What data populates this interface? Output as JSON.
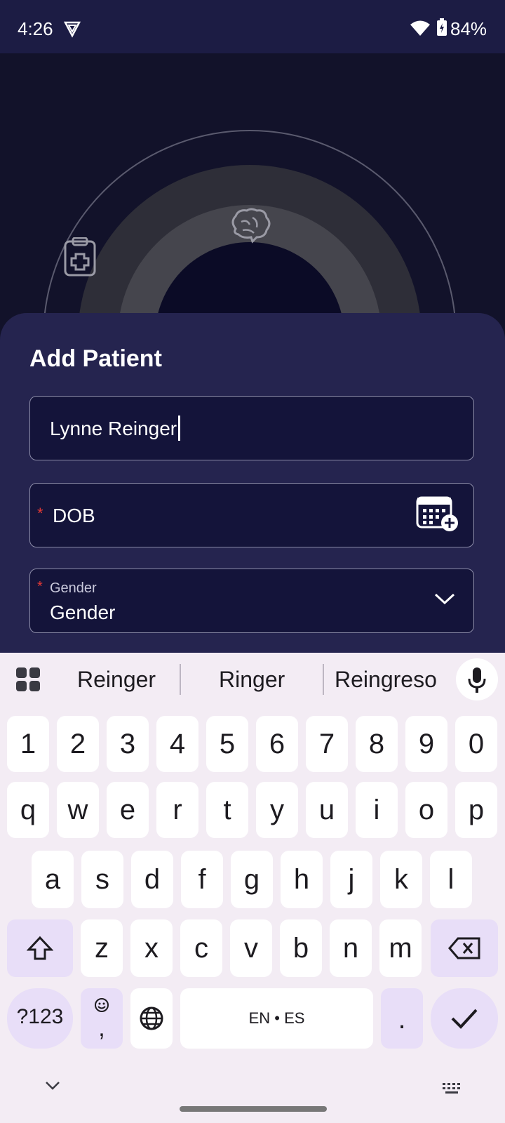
{
  "status_bar": {
    "time": "4:26",
    "battery_percent": "84%",
    "vpn_icon": "shield-vpn-icon",
    "wifi_icon": "wifi-icon",
    "battery_icon": "battery-charging-icon"
  },
  "hero": {
    "icons": [
      "clipboard-medical-icon",
      "brain-icon"
    ]
  },
  "form": {
    "title": "Add Patient",
    "name_value": "Lynne Reinger",
    "dob_label": "DOB",
    "required_mark": "*",
    "gender_floating_label": "Gender",
    "gender_value": "Gender",
    "calendar_icon": "calendar-add-icon",
    "dropdown_icon": "chevron-down-icon"
  },
  "keyboard": {
    "suggestions": [
      "Reinger",
      "Ringer",
      "Reingreso"
    ],
    "number_row": [
      "1",
      "2",
      "3",
      "4",
      "5",
      "6",
      "7",
      "8",
      "9",
      "0"
    ],
    "row1": [
      "q",
      "w",
      "e",
      "r",
      "t",
      "y",
      "u",
      "i",
      "o",
      "p"
    ],
    "row2": [
      "a",
      "s",
      "d",
      "f",
      "g",
      "h",
      "j",
      "k",
      "l"
    ],
    "row3": [
      "z",
      "x",
      "c",
      "v",
      "b",
      "n",
      "m"
    ],
    "symbols_key": "?123",
    "emoji_comma_key": ",",
    "space_label": "EN • ES",
    "period_key": "."
  },
  "colors": {
    "accent": "#25244f",
    "required": "#e53935",
    "keyboard_bg": "#f3ecf4",
    "special_key": "#e8def8"
  }
}
